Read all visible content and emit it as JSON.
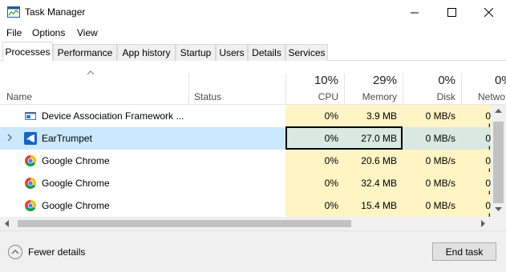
{
  "window": {
    "title": "Task Manager",
    "app_icon": "task-manager-icon"
  },
  "window_controls": [
    "minimize-icon",
    "maximize-icon",
    "close-icon"
  ],
  "menu": {
    "file": "File",
    "options": "Options",
    "view": "View"
  },
  "tabs": [
    {
      "label": "Processes",
      "active": true
    },
    {
      "label": "Performance"
    },
    {
      "label": "App history"
    },
    {
      "label": "Startup"
    },
    {
      "label": "Users"
    },
    {
      "label": "Details"
    },
    {
      "label": "Services"
    }
  ],
  "columns": {
    "name": "Name",
    "status": "Status",
    "cpu": {
      "label": "CPU",
      "pct": "10%"
    },
    "memory": {
      "label": "Memory",
      "pct": "29%"
    },
    "disk": {
      "label": "Disk",
      "pct": "0%"
    },
    "network": {
      "label": "Netwo",
      "pct": "0%"
    }
  },
  "processes": [
    {
      "name": "Device Association Framework ...",
      "cpu": "0%",
      "memory": "3.9 MB",
      "disk": "0 MB/s",
      "network": "0 I",
      "icon": "service-window-icon"
    },
    {
      "name": "EarTrumpet",
      "cpu": "0%",
      "memory": "27.0 MB",
      "disk": "0 MB/s",
      "network": "0 I",
      "icon": "eartrumpet-icon",
      "selected": true,
      "expandable": true
    },
    {
      "name": "Google Chrome",
      "cpu": "0%",
      "memory": "20.6 MB",
      "disk": "0 MB/s",
      "network": "0 I",
      "icon": "chrome-icon"
    },
    {
      "name": "Google Chrome",
      "cpu": "0%",
      "memory": "32.4 MB",
      "disk": "0 MB/s",
      "network": "0 I",
      "icon": "chrome-icon"
    },
    {
      "name": "Google Chrome",
      "cpu": "0%",
      "memory": "15.4 MB",
      "disk": "0 MB/s",
      "network": "0 I",
      "icon": "chrome-icon"
    }
  ],
  "footer": {
    "fewer_details": "Fewer details",
    "end_task": "End task"
  },
  "colors": {
    "heat": "#fff4c4",
    "selected_row": "#cce8ff",
    "chrome_red": "#db4437",
    "chrome_yellow": "#f4c20d",
    "chrome_green": "#0f9d58",
    "chrome_blue": "#4285f4"
  }
}
